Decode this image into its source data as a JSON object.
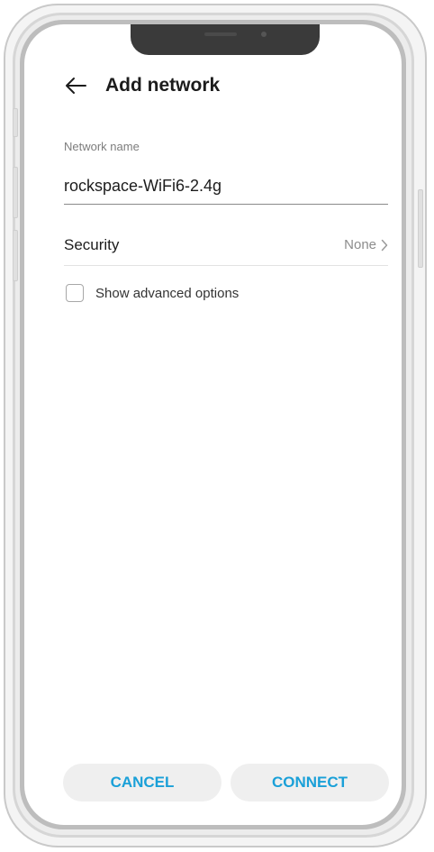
{
  "header": {
    "title": "Add network"
  },
  "network_name": {
    "label": "Network name",
    "value": "rockspace-WiFi6-2.4g"
  },
  "security": {
    "label": "Security",
    "value": "None"
  },
  "advanced": {
    "label": "Show advanced options",
    "checked": false
  },
  "buttons": {
    "cancel": "CANCEL",
    "connect": "CONNECT"
  },
  "colors": {
    "accent": "#1aa0d8",
    "button_bg": "#efefef",
    "notch": "#3a3a3a"
  },
  "icons": {
    "back": "arrow-left-icon",
    "chevron": "chevron-right-icon",
    "checkbox": "checkbox-unchecked-icon"
  }
}
